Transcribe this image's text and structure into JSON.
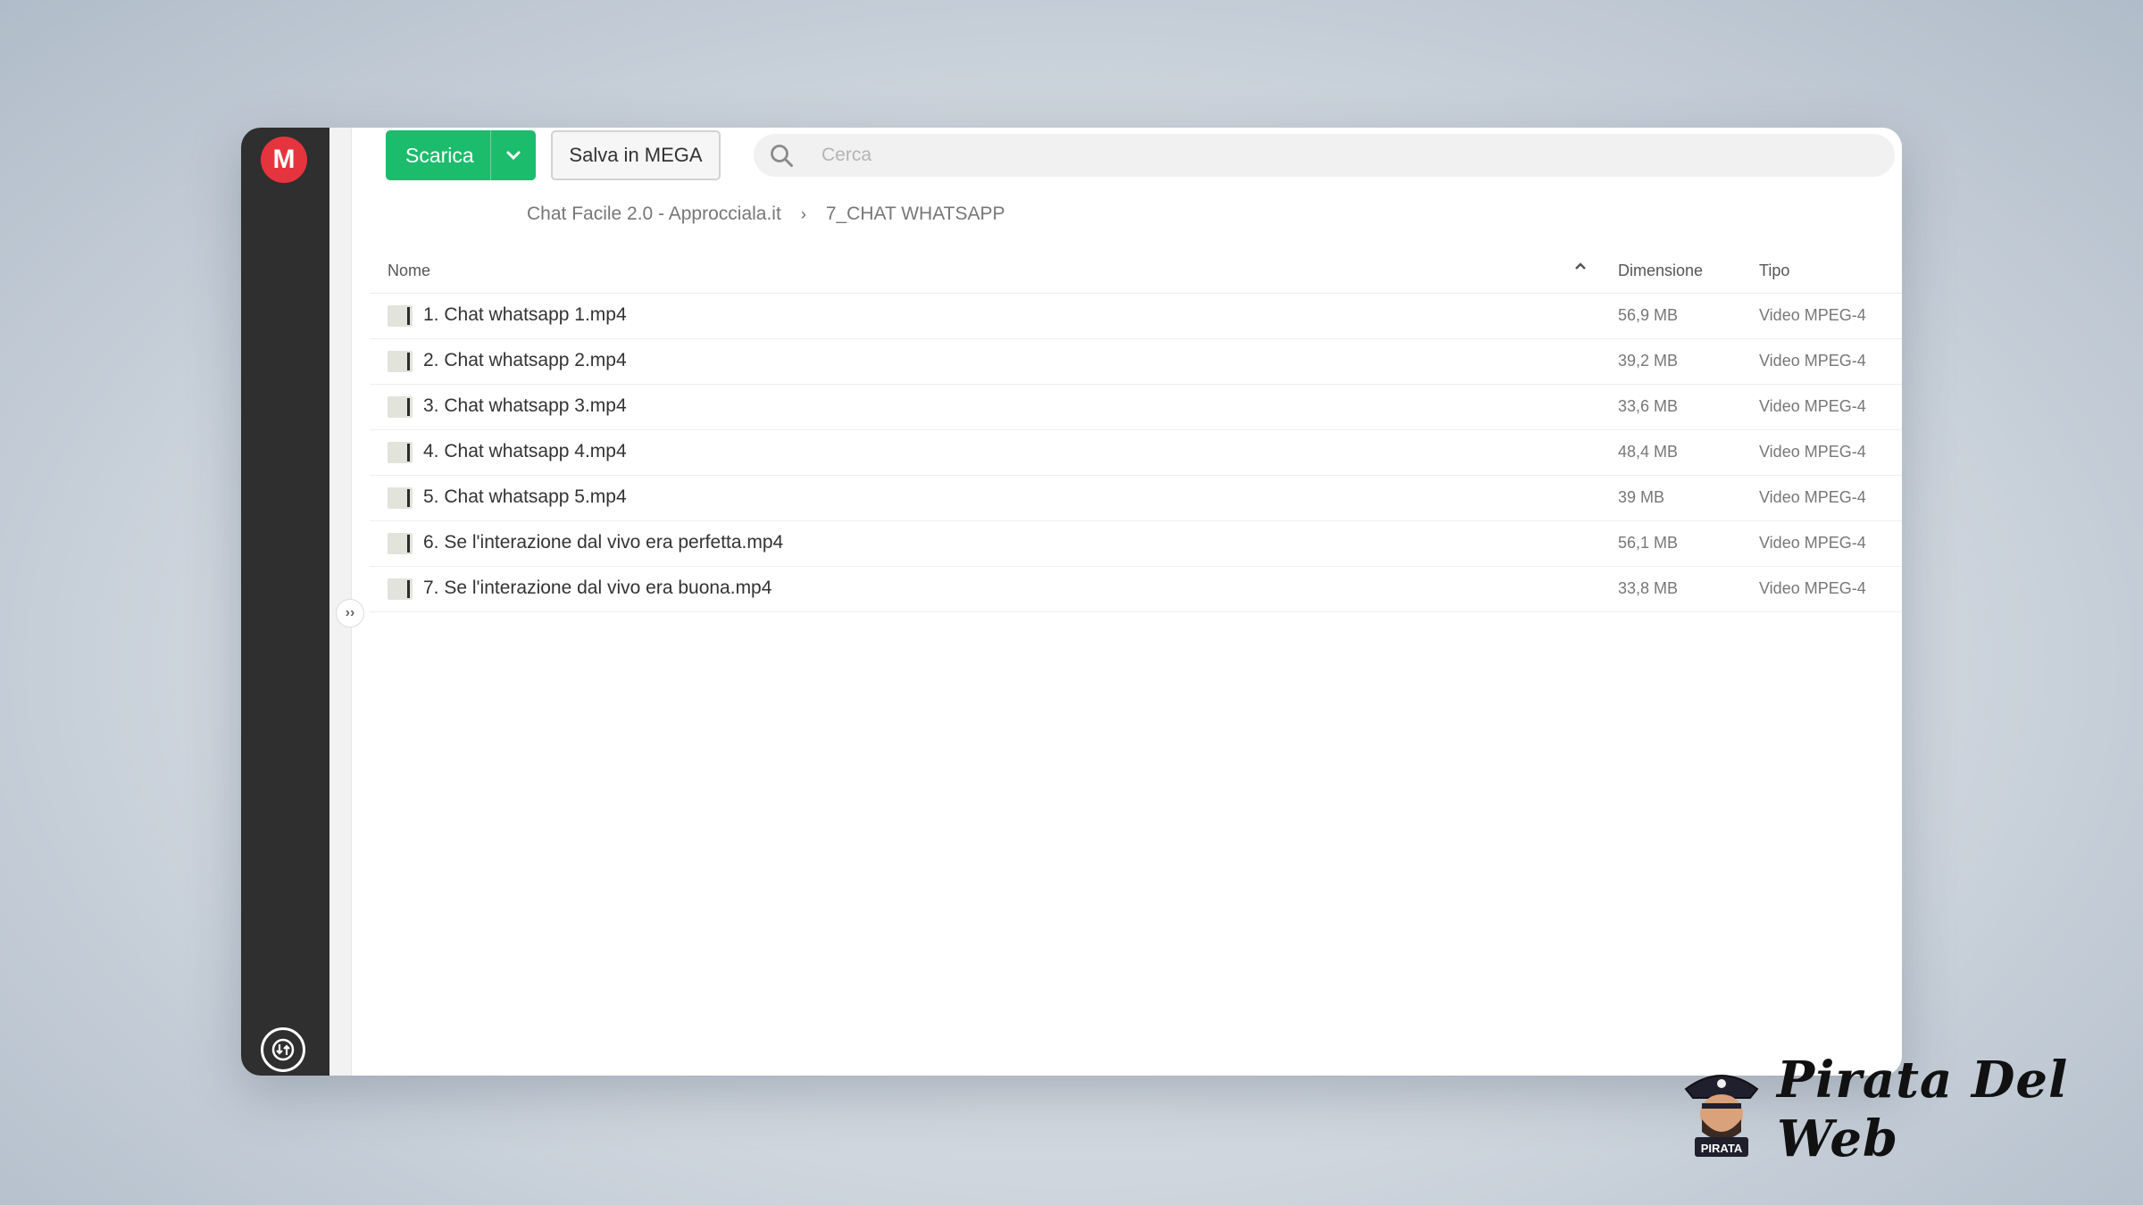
{
  "toolbar": {
    "download_label": "Scarica",
    "save_label": "Salva in MEGA",
    "search_placeholder": "Cerca"
  },
  "breadcrumb": {
    "items": [
      "Chat Facile 2.0 - Approcciala.it",
      "7_CHAT WHATSAPP"
    ]
  },
  "table": {
    "headers": {
      "name": "Nome",
      "size": "Dimensione",
      "type": "Tipo"
    },
    "rows": [
      {
        "name": "1. Chat whatsapp 1.mp4",
        "size": "56,9 MB",
        "type": "Video MPEG-4"
      },
      {
        "name": "2. Chat whatsapp 2.mp4",
        "size": "39,2 MB",
        "type": "Video MPEG-4"
      },
      {
        "name": "3. Chat whatsapp 3.mp4",
        "size": "33,6 MB",
        "type": "Video MPEG-4"
      },
      {
        "name": "4. Chat whatsapp 4.mp4",
        "size": "48,4 MB",
        "type": "Video MPEG-4"
      },
      {
        "name": "5. Chat whatsapp 5.mp4",
        "size": "39 MB",
        "type": "Video MPEG-4"
      },
      {
        "name": "6. Se l'interazione dal vivo era perfetta.mp4",
        "size": "56,1 MB",
        "type": "Video MPEG-4"
      },
      {
        "name": "7. Se l'interazione dal vivo era buona.mp4",
        "size": "33,8 MB",
        "type": "Video MPEG-4"
      }
    ]
  },
  "sidebar": {
    "logo_letter": "M"
  },
  "brand": {
    "name": "Pirata Del Web",
    "badge": "PIRATA"
  },
  "colors": {
    "accent_green": "#1cbc6d",
    "mega_red": "#e6343f",
    "sidebar_dark": "#2f2f2f"
  },
  "icons": {
    "search": "search-icon",
    "dropdown": "chevron-down-icon",
    "sort": "chevron-up-icon",
    "expand": "double-chevron-right-icon",
    "transfers": "transfer-icon",
    "file": "video-thumbnail-icon"
  }
}
